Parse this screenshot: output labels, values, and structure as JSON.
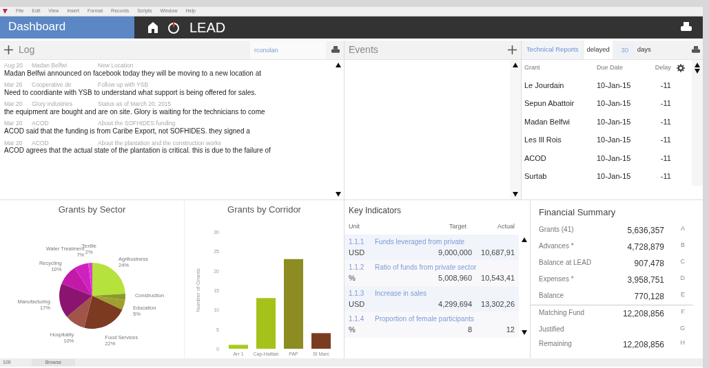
{
  "menu": [
    "File",
    "Edit",
    "View",
    "Insert",
    "Format",
    "Records",
    "Scripts",
    "Window",
    "Help"
  ],
  "header": {
    "title": "Dashboard",
    "org": "LEAD"
  },
  "log": {
    "title": "Log",
    "search": {
      "value": "rconolan"
    },
    "entries": [
      {
        "date": "Aug 20",
        "grant": "Madan Belfwi",
        "subject": "New Location",
        "text": "Madan Belfwi announced on facebook today they will be moving to a new location at"
      },
      {
        "date": "Mar 26",
        "grant": "Cooperative de",
        "subject": "Follow up with YSB",
        "text": "Need to coordiante with YSB to understand what support is being offered for sales."
      },
      {
        "date": "Mar 20",
        "grant": "Glory industries",
        "subject": "Status as of March 20, 2015",
        "text": "the equipment are bought and are on site.  Glory is waiting for the technicians to come"
      },
      {
        "date": "Mar 20",
        "grant": "ACOD",
        "subject": "About the SOFHIDES funding",
        "text": "ACOD said that the funding is from Caribe Export, not SOFHIDES. they signed a"
      },
      {
        "date": "Mar 20",
        "grant": "ACOD",
        "subject": "About the plantation and the construction works",
        "text": "ACOD agrees that the actual state of the plantation is critical. this is due to the failure of"
      }
    ]
  },
  "events": {
    "title": "Events"
  },
  "technical_reports": {
    "title": "Technical Reports",
    "filter_label": "delayed",
    "days": {
      "value": "30"
    },
    "unit": "days",
    "columns": [
      "Grant",
      "Due Date",
      "Delay"
    ],
    "rows": [
      {
        "grant": "Le Jourdain",
        "due": "10-Jan-15",
        "delay": "-11"
      },
      {
        "grant": "Sepun Abattoir",
        "due": "10-Jan-15",
        "delay": "-11"
      },
      {
        "grant": "Madan Belfwi",
        "due": "10-Jan-15",
        "delay": "-11"
      },
      {
        "grant": "Les Ill Rois",
        "due": "10-Jan-15",
        "delay": "-11"
      },
      {
        "grant": "ACOD",
        "due": "10-Jan-15",
        "delay": "-11"
      },
      {
        "grant": "Surtab",
        "due": "10-Jan-15",
        "delay": "-11"
      }
    ]
  },
  "sector_chart": {
    "chart_data": {
      "type": "pie",
      "title": "Grants by Sector",
      "categories": [
        "Agribusiness",
        "Construction",
        "Education",
        "Food Services",
        "Hospitality",
        "Manufacturing",
        "Recycling",
        "Water Treatment",
        "Textile"
      ],
      "values": [
        24,
        3,
        5,
        22,
        10,
        17,
        10,
        7,
        2
      ],
      "value_labels": [
        "24%",
        null,
        "5%",
        "22%",
        "10%",
        "17%",
        "10%",
        "7%",
        "2%"
      ],
      "colors": [
        "#b5e23c",
        "#8a9a2a",
        "#a0a030",
        "#7c3a22",
        "#a05548",
        "#8a1470",
        "#c21aa8",
        "#d020c0",
        "#e040d0"
      ]
    }
  },
  "corridor_chart": {
    "chart_data": {
      "type": "bar",
      "title": "Grants by Corridor",
      "ylabel": "Number of Grants",
      "categories": [
        "Arr 1",
        "Cap-Haitian",
        "PAP",
        "St Marc"
      ],
      "values": [
        1,
        13,
        23,
        4
      ],
      "colors": [
        "#a6cc1e",
        "#a4c21a",
        "#8c8c22",
        "#7a3c20"
      ],
      "ylim": [
        0,
        30
      ],
      "yticks": [
        0,
        5,
        10,
        15,
        20,
        25,
        30
      ]
    }
  },
  "key_indicators": {
    "title": "Key Indicators",
    "columns": [
      "Unit",
      "Target",
      "Actual"
    ],
    "rows": [
      {
        "code": "1.1.1",
        "title": "Funds leveraged from private",
        "unit": "USD",
        "target": "9,000,000",
        "actual": "10,687,91"
      },
      {
        "code": "1.1.2",
        "title": "Ratio of funds from private sector",
        "unit": "%",
        "target": "5,008,960",
        "actual": "10,543,41"
      },
      {
        "code": "1.1.3",
        "title": "Increase in sales",
        "unit": "USD",
        "target": "4,299,694",
        "actual": "13,302,26"
      },
      {
        "code": "1.1.4",
        "title": "Proportion of female participants",
        "unit": "%",
        "target": "8",
        "actual": "12"
      }
    ]
  },
  "financial_summary": {
    "title": "Financial Summary",
    "rows": [
      {
        "label": "Grants (41)",
        "value": "5,636,357",
        "letter": "A"
      },
      {
        "label": "Advances *",
        "value": "4,728,879",
        "letter": "B"
      },
      {
        "label": "Balance at LEAD",
        "value": "907,478",
        "letter": "C"
      },
      {
        "label": "Expenses *",
        "value": "3,958,751",
        "letter": "D"
      },
      {
        "label": "Balance",
        "value": "770,128",
        "letter": "E"
      }
    ],
    "matching_rows": [
      {
        "label": "Matching Fund",
        "value": "12,208,856",
        "letter": "F"
      },
      {
        "label": "Justified",
        "letter": "G"
      },
      {
        "label": "Remaining",
        "value": "12,208,856",
        "letter": "H"
      }
    ]
  },
  "status_bar": {
    "zoom": "100",
    "mode": "Browse"
  }
}
